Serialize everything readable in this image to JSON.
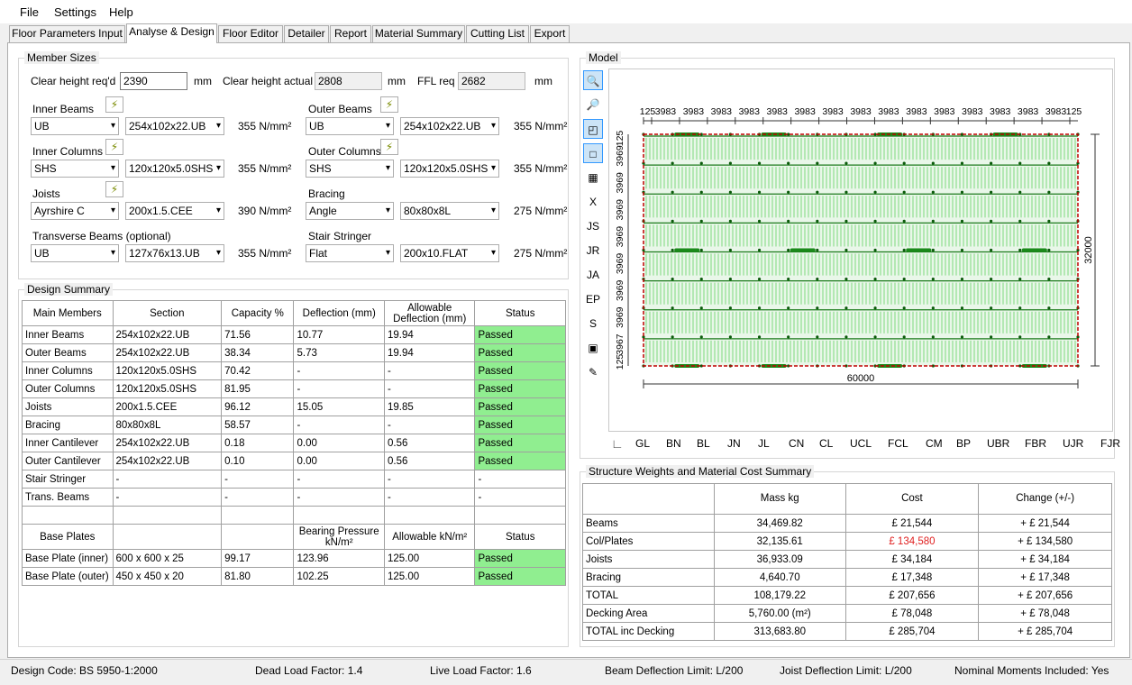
{
  "menu": {
    "items": [
      "File",
      "Settings",
      "Help"
    ]
  },
  "tabs": [
    "Floor Parameters Input",
    "Analyse & Design",
    "Floor Editor",
    "Detailer",
    "Report",
    "Material Summary",
    "Cutting List",
    "Export"
  ],
  "member_sizes": {
    "title": "Member Sizes",
    "clear_height_req_label": "Clear height req'd",
    "clear_height_req_value": "2390",
    "clear_height_actual_label": "Clear height actual",
    "clear_height_actual_value": "2808",
    "ffl_req_label": "FFL req",
    "ffl_req_value": "2682",
    "unit_mm": "mm",
    "rows": [
      {
        "left": {
          "label": "Inner Beams",
          "type": "UB",
          "section": "254x102x22.UB",
          "strength": "355 N/mm²"
        },
        "right": {
          "label": "Outer Beams",
          "type": "UB",
          "section": "254x102x22.UB",
          "strength": "355 N/mm²"
        }
      },
      {
        "left": {
          "label": "Inner Columns",
          "type": "SHS",
          "section": "120x120x5.0SHS",
          "strength": "355 N/mm²"
        },
        "right": {
          "label": "Outer Columns",
          "type": "SHS",
          "section": "120x120x5.0SHS",
          "strength": "355 N/mm²"
        }
      },
      {
        "left": {
          "label": "Joists",
          "type": "Ayrshire C",
          "section": "200x1.5.CEE",
          "strength": "390 N/mm²"
        },
        "right": {
          "label": "Bracing",
          "type": "Angle",
          "section": "80x80x8L",
          "strength": "275 N/mm²"
        }
      },
      {
        "left": {
          "label": "Transverse Beams (optional)",
          "type": "UB",
          "section": "127x76x13.UB",
          "strength": "355 N/mm²"
        },
        "right": {
          "label": "Stair Stringer",
          "type": "Flat",
          "section": "200x10.FLAT",
          "strength": "275 N/mm²"
        }
      }
    ]
  },
  "design_summary": {
    "title": "Design Summary",
    "headers": [
      "Main Members",
      "Section",
      "Capacity %",
      "Deflection (mm)",
      "Allowable Deflection (mm)",
      "Status"
    ],
    "rows": [
      [
        "Inner Beams",
        "254x102x22.UB",
        "71.56",
        "10.77",
        "19.94",
        "Passed"
      ],
      [
        "Outer Beams",
        "254x102x22.UB",
        "38.34",
        "5.73",
        "19.94",
        "Passed"
      ],
      [
        "Inner Columns",
        "120x120x5.0SHS",
        "70.42",
        "-",
        "-",
        "Passed"
      ],
      [
        "Outer Columns",
        "120x120x5.0SHS",
        "81.95",
        "-",
        "-",
        "Passed"
      ],
      [
        "Joists",
        "200x1.5.CEE",
        "96.12",
        "15.05",
        "19.85",
        "Passed"
      ],
      [
        "Bracing",
        "80x80x8L",
        "58.57",
        "-",
        "-",
        "Passed"
      ],
      [
        "Inner Cantilever",
        "254x102x22.UB",
        "0.18",
        "0.00",
        "0.56",
        "Passed"
      ],
      [
        "Outer Cantilever",
        "254x102x22.UB",
        "0.10",
        "0.00",
        "0.56",
        "Passed"
      ],
      [
        "Stair Stringer",
        "-",
        "-",
        "-",
        "-",
        "-"
      ],
      [
        "Trans. Beams",
        "-",
        "-",
        "-",
        "-",
        "-"
      ]
    ],
    "bp_headers": [
      "Base Plates",
      "",
      "Bearing Pressure kN/m²",
      "Allowable kN/m²",
      "Status"
    ],
    "bp_rows": [
      [
        "Base Plate (inner)",
        "600 x 600 x 25",
        "99.17",
        "123.96",
        "125.00",
        "Passed"
      ],
      [
        "Base Plate (outer)",
        "450 x 450 x 20",
        "81.80",
        "102.25",
        "125.00",
        "Passed"
      ]
    ]
  },
  "model": {
    "title": "Model",
    "tools": [
      "zoom-icon",
      "zoom-window-icon",
      "select-icon",
      "rectangle-icon",
      "grid-icon",
      "X",
      "JS",
      "JR",
      "JA",
      "EP",
      "S",
      "save-icon",
      "paint-icon"
    ],
    "top_dims": [
      "125",
      "3983",
      "3983",
      "3983",
      "3983",
      "3983",
      "3983",
      "3983",
      "3983",
      "3983",
      "3983",
      "3983",
      "3983",
      "3983",
      "3983",
      "3983",
      "125"
    ],
    "left_dims": [
      "125",
      "3969",
      "3969",
      "3969",
      "3969",
      "3969",
      "3969",
      "3969",
      "3967",
      "125"
    ],
    "width_dim": "60000",
    "height_dim": "32000",
    "layers": [
      "GL",
      "BN",
      "BL",
      "JN",
      "JL",
      "CN",
      "CL",
      "UCL",
      "FCL",
      "CM",
      "BP",
      "UBR",
      "FBR",
      "UJR",
      "FJR"
    ]
  },
  "weights": {
    "title": "Structure Weights and Material Cost Summary",
    "headers": [
      "",
      "Mass kg",
      "Cost",
      "Change (+/-)"
    ],
    "rows": [
      [
        "Beams",
        "34,469.82",
        "£ 21,544",
        "+ £ 21,544"
      ],
      [
        "Col/Plates",
        "32,135.61",
        "£ 134,580",
        "+ £ 134,580"
      ],
      [
        "Joists",
        "36,933.09",
        "£ 34,184",
        "+ £ 34,184"
      ],
      [
        "Bracing",
        "4,640.70",
        "£ 17,348",
        "+ £ 17,348"
      ],
      [
        "TOTAL",
        "108,179.22",
        "£ 207,656",
        "+ £ 207,656"
      ],
      [
        "Decking Area",
        "5,760.00 (m²)",
        "£ 78,048",
        "+ £ 78,048"
      ],
      [
        "TOTAL inc Decking",
        "313,683.80",
        "£ 285,704",
        "+ £ 285,704"
      ]
    ],
    "highlight_color": "#e02020"
  },
  "status": {
    "design_code": "Design Code:  BS 5950-1:2000",
    "dead_load": "Dead Load Factor: 1.4",
    "live_load": "Live Load Factor: 1.6",
    "beam_defl": "Beam Deflection Limit: L/200",
    "joist_defl": "Joist Deflection Limit: L/200",
    "nominal": "Nominal Moments Included: Yes"
  },
  "colors": {
    "passed": "#90ee90",
    "frame_red": "#c00000",
    "joist_green": "#7dd87d"
  }
}
